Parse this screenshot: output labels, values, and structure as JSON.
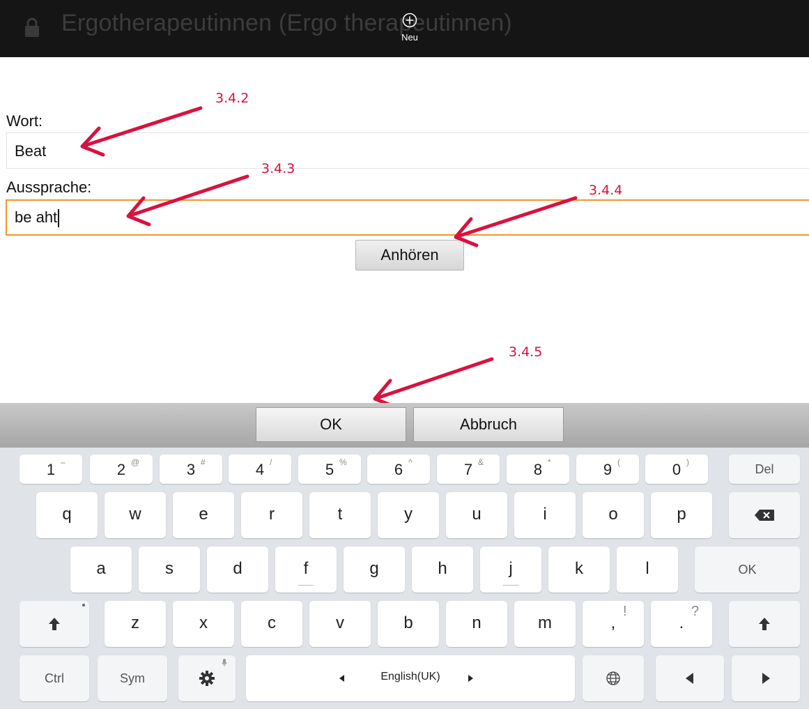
{
  "app": {
    "title": "Ergotherapeutinnen (Ergo therapeutinnen)",
    "new_label": "Neu"
  },
  "form": {
    "word_label": "Wort:",
    "word_value": "Beat",
    "pronunciation_label": "Aussprache:",
    "pronunciation_value": "be aht",
    "listen_button": "Anhören"
  },
  "annotations": [
    "3.4.2",
    "3.4.3",
    "3.4.4",
    "3.4.5"
  ],
  "dialog": {
    "ok_label": "OK",
    "cancel_label": "Abbruch"
  },
  "keyboard": {
    "row1": [
      {
        "main": "1",
        "sub": "–"
      },
      {
        "main": "2",
        "sub": "@"
      },
      {
        "main": "3",
        "sub": "#"
      },
      {
        "main": "4",
        "sub": "/"
      },
      {
        "main": "5",
        "sub": "%"
      },
      {
        "main": "6",
        "sub": "^"
      },
      {
        "main": "7",
        "sub": "&"
      },
      {
        "main": "8",
        "sub": "*"
      },
      {
        "main": "9",
        "sub": "("
      },
      {
        "main": "0",
        "sub": ")"
      }
    ],
    "del_label": "Del",
    "row2": [
      "q",
      "w",
      "e",
      "r",
      "t",
      "y",
      "u",
      "i",
      "o",
      "p"
    ],
    "row3": [
      "a",
      "s",
      "d",
      "f",
      "g",
      "h",
      "j",
      "k",
      "l"
    ],
    "ok_key_label": "OK",
    "row4": [
      {
        "main": "z",
        "sub": ""
      },
      {
        "main": "x",
        "sub": ""
      },
      {
        "main": "c",
        "sub": ""
      },
      {
        "main": "v",
        "sub": ""
      },
      {
        "main": "b",
        "sub": ""
      },
      {
        "main": "n",
        "sub": ""
      },
      {
        "main": "m",
        "sub": ""
      },
      {
        "main": ",",
        "sub": "!"
      },
      {
        "main": ".",
        "sub": "?"
      }
    ],
    "ctrl_label": "Ctrl",
    "sym_label": "Sym",
    "language_label": "English(UK)"
  },
  "colors": {
    "annotation": "#d8123f",
    "focus_border": "#f2962c",
    "topbar": "#151515"
  }
}
